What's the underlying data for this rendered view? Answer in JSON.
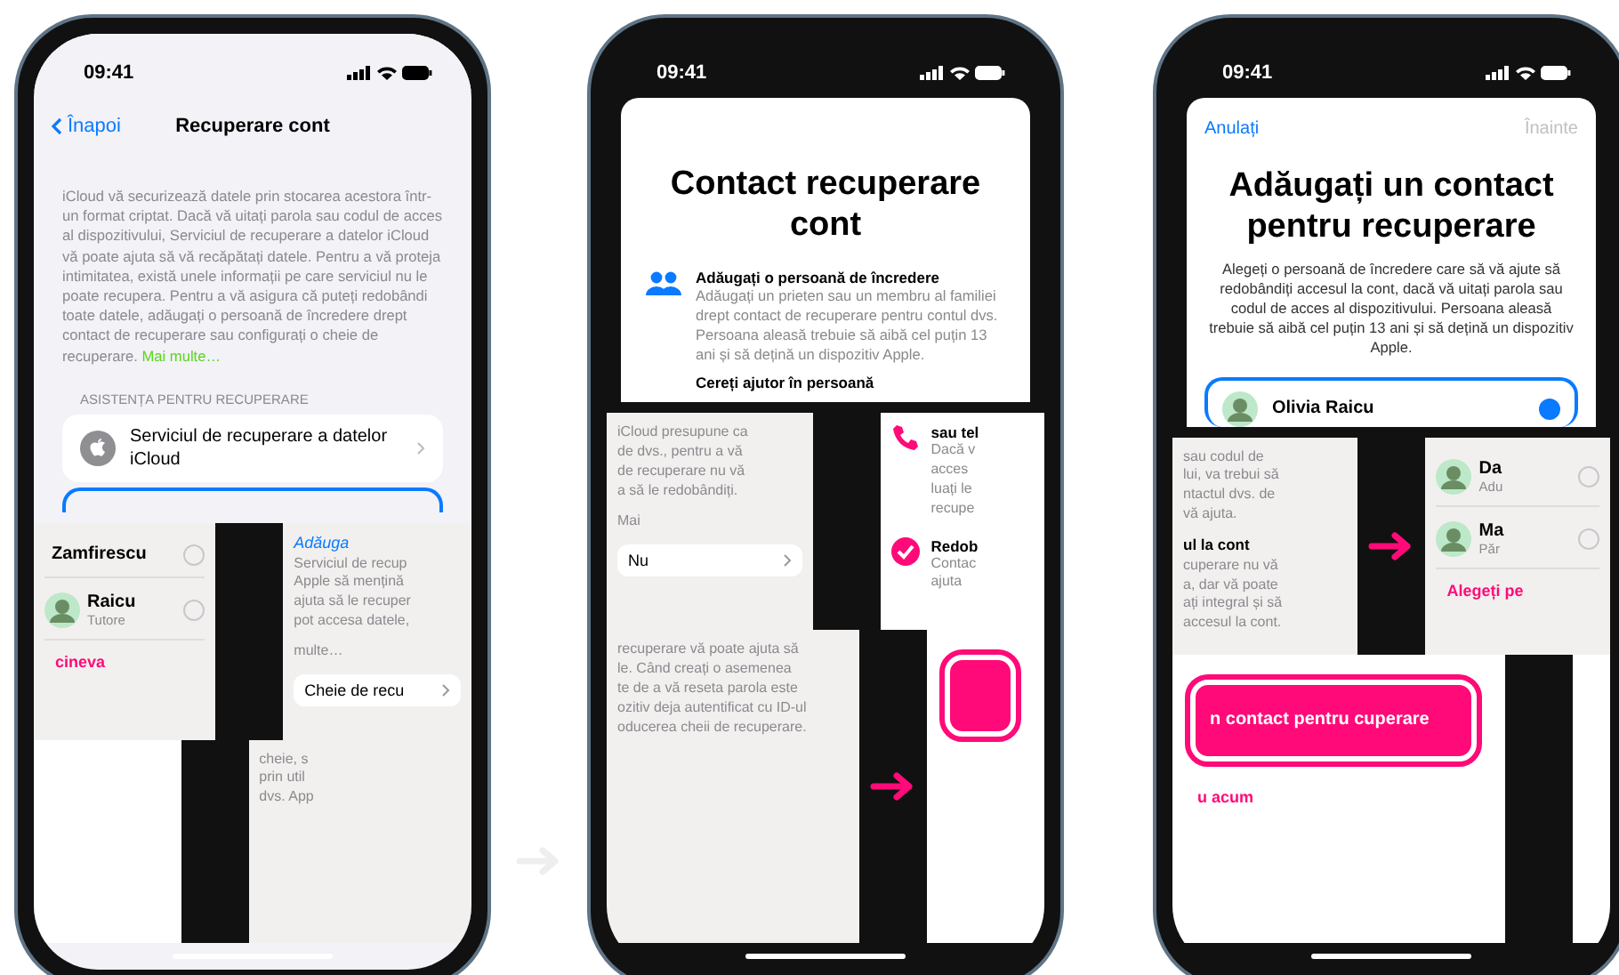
{
  "screen_1": {
    "time": "09:41",
    "back": "Înapoi",
    "title": "Recuperare cont",
    "description": "iCloud vă securizează datele prin stocarea acestora într-un format criptat. Dacă vă uitați parola sau codul de acces al dispozitivului, Serviciul de recuperare a datelor iCloud vă poate ajuta să vă recăpătați datele. Pentru a vă proteja intimitatea, există unele informații pe care serviciul nu le poate recupera. Pentru a vă asigura că puteți redobândi toate datele, adăugați o persoană de încredere drept contact de recuperare sau configurați o cheie de recuperare.",
    "more_link": "Mai multe…",
    "section_header": "ASISTENȚA PENTRU RECUPERARE",
    "row": "Serviciul de recuperare a datelor iCloud",
    "band": {
      "left": {
        "kind": "contacts",
        "contacts": [
          {
            "name": "Zamfirescu",
            "selected": false
          },
          {
            "name": "Raicu",
            "subtitle": "Tutore",
            "selected": false
          }
        ],
        "action": "cineva"
      },
      "right": {
        "kind": "text",
        "link": "Adăuga",
        "lines": [
          "Serviciul de recup",
          "Apple să mențină",
          "ajuta să le recuper",
          "pot accesa datele,"
        ],
        "more": "multe…",
        "row": "Cheie de recu"
      }
    },
    "footer": {
      "left": {
        "kind": "blank"
      },
      "right": {
        "kind": "text",
        "lines": [
          "cheie, s",
          "prin util",
          "dvs. App"
        ]
      }
    }
  },
  "screen_2": {
    "time": "09:41",
    "title": "Contact recuperare cont",
    "heading": "Adăugați o persoană de încredere",
    "text": "Adăugați un prieten sau un membru al familiei drept contact de recuperare pentru contul dvs. Persoana aleasă trebuie să aibă cel puțin 13 ani și să dețină un dispozitiv Apple.",
    "heading_2": "Cereți ajutor în persoană",
    "band": {
      "left": {
        "kind": "text",
        "lines": [
          "iCloud presupune ca",
          "de dvs., pentru a vă",
          "de recuperare nu vă",
          "a să le redobândiți."
        ],
        "more": "Mai",
        "row": "Nu"
      },
      "right": {
        "kind": "features",
        "items": [
          {
            "kind": "phone",
            "title": "sau tel",
            "lines": [
              "Dacă v",
              "acces",
              "luați le",
              "recupe"
            ]
          },
          {
            "kind": "check",
            "title": "Redob",
            "lines": [
              "Contac",
              "ajuta"
            ]
          }
        ]
      }
    },
    "footer": {
      "left": {
        "kind": "text",
        "lines": [
          "recuperare vă poate ajuta să",
          "le. Când creați o asemenea",
          "te de a vă reseta parola este",
          "ozitiv deja autentificat cu ID-ul",
          "oducerea cheii de recuperare."
        ]
      },
      "right": {
        "kind": "button"
      }
    }
  },
  "screen_3": {
    "time": "09:41",
    "cancel": "Anulați",
    "next": {
      "label": "Înainte",
      "disabled": true
    },
    "title": "Adăugați un contact pentru recuperare",
    "text": "Alegeți o persoană de încredere care să vă ajute să redobândiți accesul la cont, dacă vă uitați parola sau codul de acces al dispozitivului. Persoana aleasă trebuie să aibă cel puțin 13 ani și să dețină un dispozitiv Apple.",
    "contact": {
      "name": "Olivia Raicu",
      "selected": true
    },
    "band": {
      "left": {
        "kind": "text",
        "lines": [
          "sau codul de",
          "lui, va trebui să",
          "ntactul dvs. de",
          "vă ajuta."
        ],
        "heading": "ul la cont",
        "lines_2": [
          "cuperare nu vă",
          "a, dar vă poate",
          "ați integral și să",
          "accesul la cont."
        ]
      },
      "right": {
        "kind": "contacts",
        "contacts": [
          {
            "name": "Da",
            "subtitle": "Adu",
            "selected": false
          },
          {
            "name": "Ma",
            "subtitle": "Păr",
            "selected": false
          }
        ],
        "action": "Alegeți pe"
      }
    },
    "footer": {
      "left": {
        "kind": "button",
        "label": "n contact pentru cuperare",
        "link": "u acum"
      },
      "right": {
        "kind": "blank"
      }
    }
  }
}
